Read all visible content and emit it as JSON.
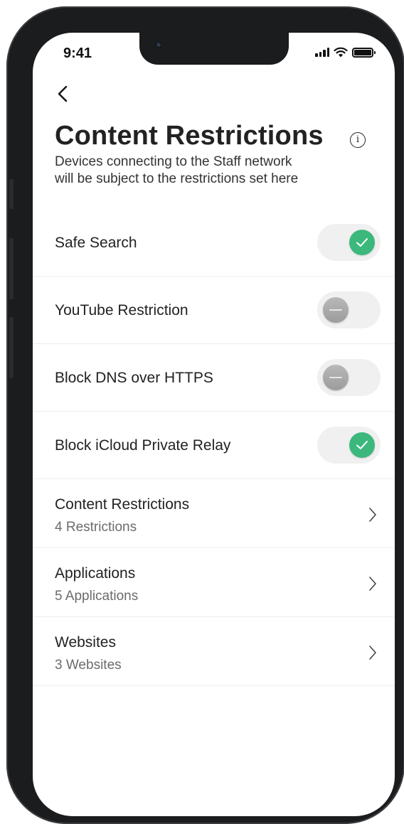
{
  "status_bar": {
    "time": "9:41"
  },
  "header": {
    "title": "Content Restrictions",
    "info_symbol": "i",
    "description_line1": "Devices connecting to the Staff network",
    "description_line2": "will be subject to the restrictions set here"
  },
  "toggles": [
    {
      "label": "Safe Search",
      "state": "on"
    },
    {
      "label": "YouTube Restriction",
      "state": "off"
    },
    {
      "label": "Block DNS over HTTPS",
      "state": "off"
    },
    {
      "label": "Block iCloud Private Relay",
      "state": "on"
    }
  ],
  "nav_items": [
    {
      "label": "Content Restrictions",
      "sub": "4 Restrictions"
    },
    {
      "label": "Applications",
      "sub": "5 Applications"
    },
    {
      "label": "Websites",
      "sub": "3 Websites"
    }
  ],
  "colors": {
    "toggle_on": "#3cb87d",
    "toggle_off_knob": "#aaa9a9",
    "toggle_track": "#f0f0f0"
  },
  "icons": [
    "back-chevron-icon",
    "info-icon",
    "check-icon",
    "dash-icon",
    "chevron-right-icon",
    "signal-icon",
    "wifi-icon",
    "battery-icon"
  ]
}
